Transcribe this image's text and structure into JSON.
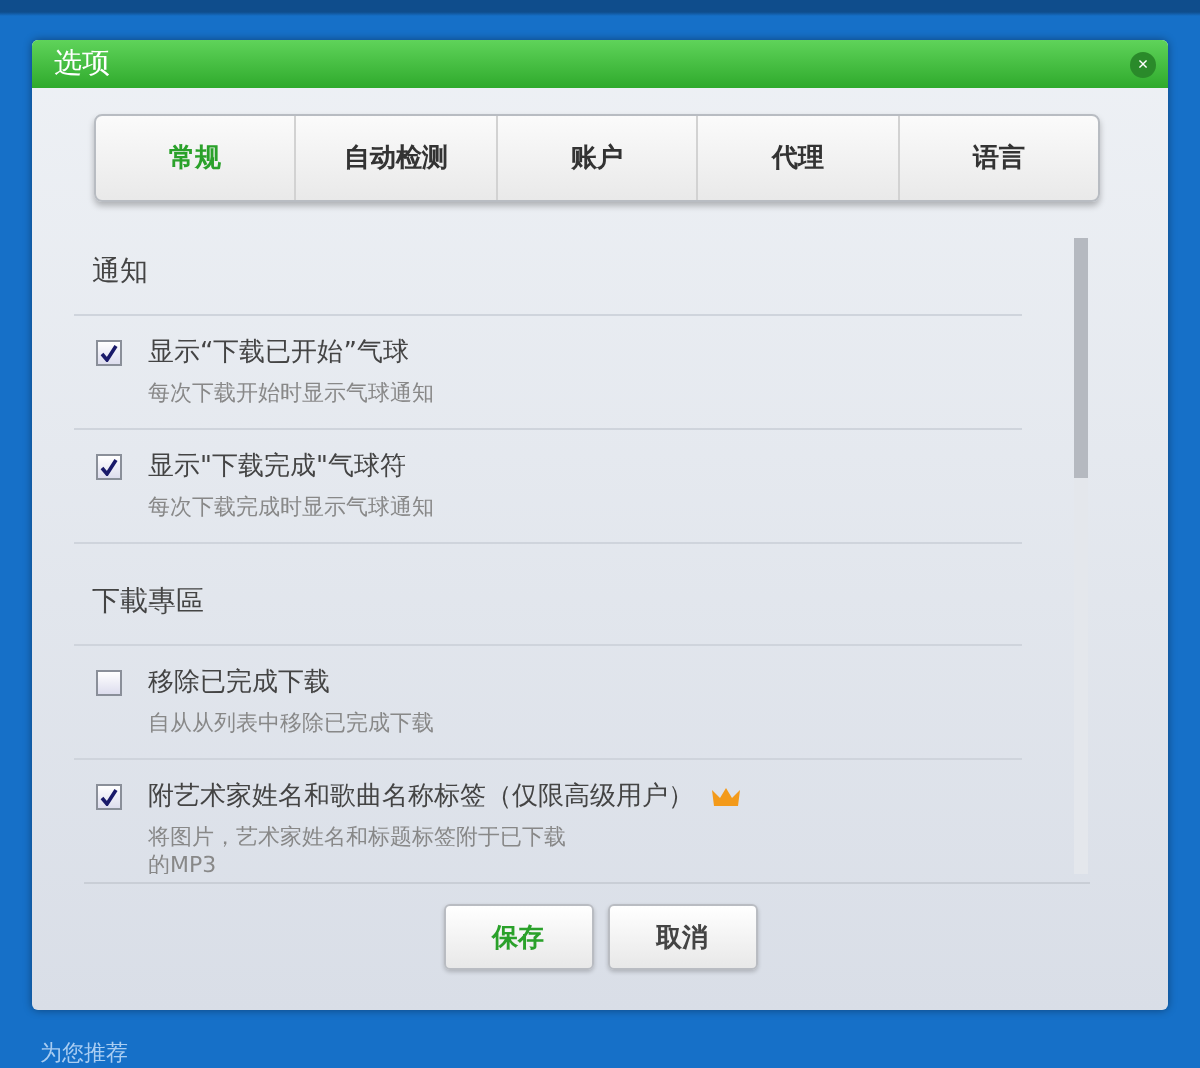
{
  "window": {
    "title": "选项",
    "close": "×"
  },
  "tabs": [
    {
      "label": "常规",
      "selected": true
    },
    {
      "label": "自动检测",
      "selected": false
    },
    {
      "label": "账户",
      "selected": false
    },
    {
      "label": "代理",
      "selected": false
    },
    {
      "label": "语言",
      "selected": false
    }
  ],
  "sections": [
    {
      "title": "通知",
      "options": [
        {
          "label": "显示“下载已开始”气球",
          "description": "每次下载开始时显示气球通知",
          "checked": true,
          "premium": false
        },
        {
          "label": "显示\"下载完成\"气球符",
          "description": "每次下载完成时显示气球通知",
          "checked": true,
          "premium": false
        }
      ]
    },
    {
      "title": "下載專區",
      "options": [
        {
          "label": "移除已完成下载",
          "description": "自从从列表中移除已完成下载",
          "checked": false,
          "premium": false
        },
        {
          "label": "附艺术家姓名和歌曲名称标签（仅限高级用户）",
          "description": "将图片，艺术家姓名和标题标签附于已下载的MP3",
          "checked": true,
          "premium": true
        }
      ]
    }
  ],
  "buttons": [
    {
      "label": "保存",
      "kind": "primary"
    },
    {
      "label": "取消",
      "kind": "secondary"
    }
  ],
  "background": {
    "footer_text": "为您推荐"
  }
}
